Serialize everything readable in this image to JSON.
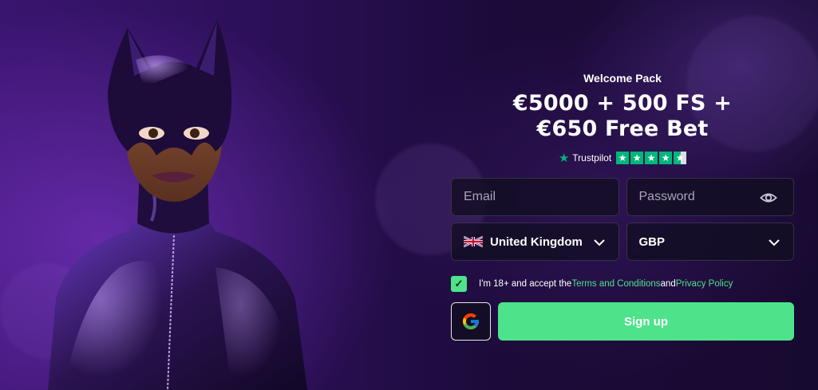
{
  "promo": {
    "welcome_label": "Welcome Pack",
    "headline_line1": "€5000 + 500 FS +",
    "headline_line2": "€650 Free Bet"
  },
  "trustpilot": {
    "name": "Trustpilot",
    "rating_stars": 4.5,
    "brand_color": "#00b67a"
  },
  "form": {
    "email_placeholder": "Email",
    "password_placeholder": "Password",
    "country_value": "United Kingdom",
    "country_flag": "uk-flag-icon",
    "currency_value": "GBP",
    "terms": {
      "checked": true,
      "prefix": "I'm 18+ and accept the ",
      "terms_link": "Terms and Conditions",
      "and": " and ",
      "privacy_link": "Privacy Policy"
    },
    "google_button_icon": "google-icon",
    "signup_label": "Sign up"
  },
  "colors": {
    "accent_green": "#4ee38a",
    "background": "#1a0a2e"
  }
}
